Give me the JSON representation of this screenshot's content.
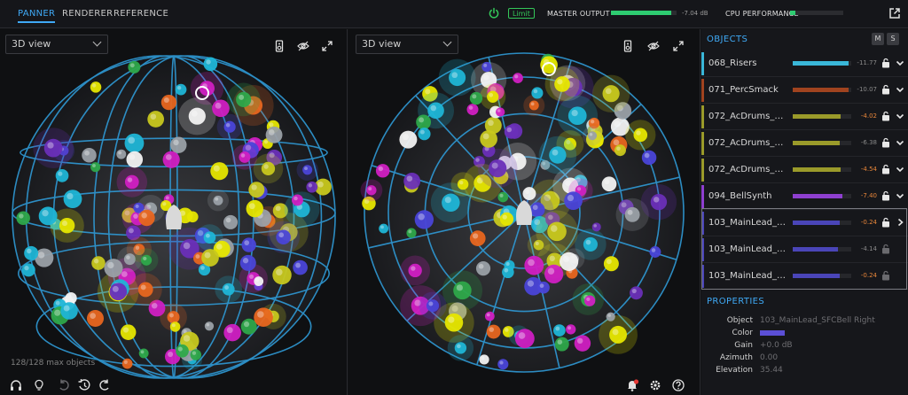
{
  "tabs": [
    {
      "label": "PANNER",
      "active": true
    },
    {
      "label": "RENDERER",
      "active": false
    },
    {
      "label": "REFERENCE",
      "active": false
    }
  ],
  "header": {
    "limit_label": "Limit",
    "master_output_label": "MASTER OUTPUT",
    "master_output_db": "-7.04 dB",
    "master_output_level": 0.92,
    "cpu_label": "CPU PERFORMANCE",
    "cpu_level": 0.1
  },
  "views": {
    "left": {
      "mode": "3D view"
    },
    "right": {
      "mode": "3D view"
    }
  },
  "status": {
    "max_objects": "128/128 max objects"
  },
  "objects_panel": {
    "title": "OBJECTS",
    "mute_label": "M",
    "solo_label": "S",
    "items": [
      {
        "name": "068_Risers",
        "gain": "-11.77",
        "color": "#3ab7d8",
        "level": 0.95,
        "hot": false
      },
      {
        "name": "071_PercSmack",
        "gain": "-10.07",
        "color": "#a0431f",
        "level": 0.95,
        "hot": false
      },
      {
        "name": "072_AcDrums_…",
        "gain": "-4.02",
        "color": "#9a9a2a",
        "level": 0.82,
        "hot": true
      },
      {
        "name": "072_AcDrums_…",
        "gain": "-6.38",
        "color": "#9a9a2a",
        "level": 0.8,
        "hot": false
      },
      {
        "name": "072_AcDrums_…",
        "gain": "-4.54",
        "color": "#9a9a2a",
        "level": 0.82,
        "hot": true
      },
      {
        "name": "094_BellSynth",
        "gain": "-7.40",
        "color": "#8e3fcf",
        "level": 0.85,
        "hot": true
      },
      {
        "name": "103_MainLead_…",
        "gain": "-0.24",
        "color": "#4a45b8",
        "level": 0.8,
        "hot": true
      },
      {
        "name": "103_MainLead_…",
        "gain": "-4.14",
        "color": "#4a45b8",
        "level": 0.78,
        "hot": false
      },
      {
        "name": "103_MainLead_…",
        "gain": "-0.24",
        "color": "#4a45b8",
        "level": 0.8,
        "hot": true
      }
    ]
  },
  "properties": {
    "title": "PROPERTIES",
    "object_label": "Object",
    "object_value": "103_MainLead_SFCBell Right",
    "color_label": "Color",
    "color_value": "#5b4fd6",
    "gain_label": "Gain",
    "gain_value": "+0.0 dB",
    "azimuth_label": "Azimuth",
    "azimuth_value": "0.00",
    "elevation_label": "Elevation",
    "elevation_value": "35.44"
  }
}
